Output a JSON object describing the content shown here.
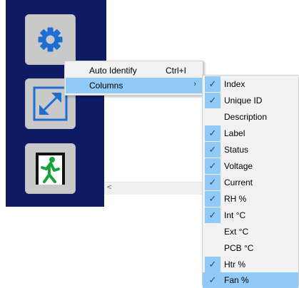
{
  "sidebar": {
    "tiles": [
      {
        "icon": "gear-icon",
        "accent": "#1e6fd1"
      },
      {
        "icon": "expand-arrows-icon",
        "accent": "#1e6fd1"
      },
      {
        "icon": "exit-door-icon",
        "accent": "#111111"
      }
    ],
    "background": "#0e1a63"
  },
  "scrollbar": {
    "left_arrow": "<"
  },
  "context_menu": {
    "items": [
      {
        "label": "Auto Identify",
        "shortcut": "Ctrl+I"
      },
      {
        "label": "Columns",
        "submenu_arrow": "›",
        "highlighted": true
      }
    ]
  },
  "columns_menu": {
    "check_glyph": "✓",
    "highlight_color": "#91c9f7",
    "items": [
      {
        "label": "Index",
        "checked": true
      },
      {
        "label": "Unique ID",
        "checked": true
      },
      {
        "label": "Description",
        "checked": false
      },
      {
        "label": "Label",
        "checked": true
      },
      {
        "label": "Status",
        "checked": true
      },
      {
        "label": "Voltage",
        "checked": true
      },
      {
        "label": "Current",
        "checked": true
      },
      {
        "label": "RH %",
        "checked": true
      },
      {
        "label": "Int °C",
        "checked": true
      },
      {
        "label": "Ext °C",
        "checked": false
      },
      {
        "label": "PCB °C",
        "checked": false
      },
      {
        "label": "Htr %",
        "checked": true
      },
      {
        "label": "Fan %",
        "checked": true,
        "highlighted": true
      }
    ]
  }
}
